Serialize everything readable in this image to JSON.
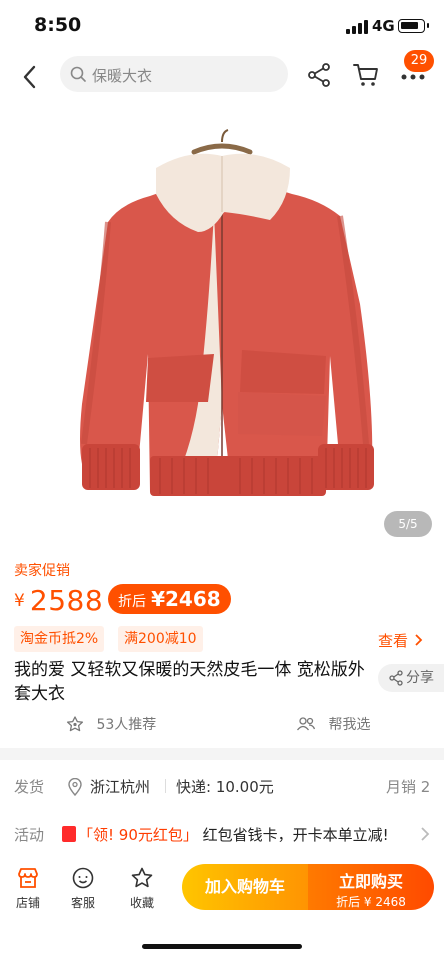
{
  "status": {
    "time": "8:50",
    "network": "4G",
    "battery_level": 0.85
  },
  "nav": {
    "search_placeholder": "保暖大衣",
    "cart_badge": "29"
  },
  "gallery": {
    "counter": "5/5"
  },
  "product": {
    "promo_tag": "卖家促销",
    "currency": "¥",
    "price": "2588",
    "after_label": "折后",
    "after_price": "¥2468",
    "coupons": [
      "淘金币抵2%",
      "满200减10"
    ],
    "see_more": "查看",
    "title": "我的爱 又轻软又保暖的天然皮毛一体 宽松版外套大衣",
    "share_label": "分享",
    "recommend": "53人推荐",
    "help_choose": "帮我选"
  },
  "shipping": {
    "label": "发货",
    "location": "浙江杭州",
    "fee": "快递: 10.00元",
    "monthly_sales": "月销 2"
  },
  "activity": {
    "label": "活动",
    "highlight": "「领! 90元红包」",
    "text": "红包省钱卡，开卡本单立减!"
  },
  "bottom": {
    "store": "店铺",
    "service": "客服",
    "favorite": "收藏",
    "add_cart": "加入购物车",
    "buy_now": "立即购买",
    "buy_sub": "折后 ¥ 2468"
  },
  "colors": {
    "accent": "#ff5000",
    "cart_btn": "#ffb000",
    "jacket": "#d9574b",
    "fleece": "#f3e7dc"
  }
}
